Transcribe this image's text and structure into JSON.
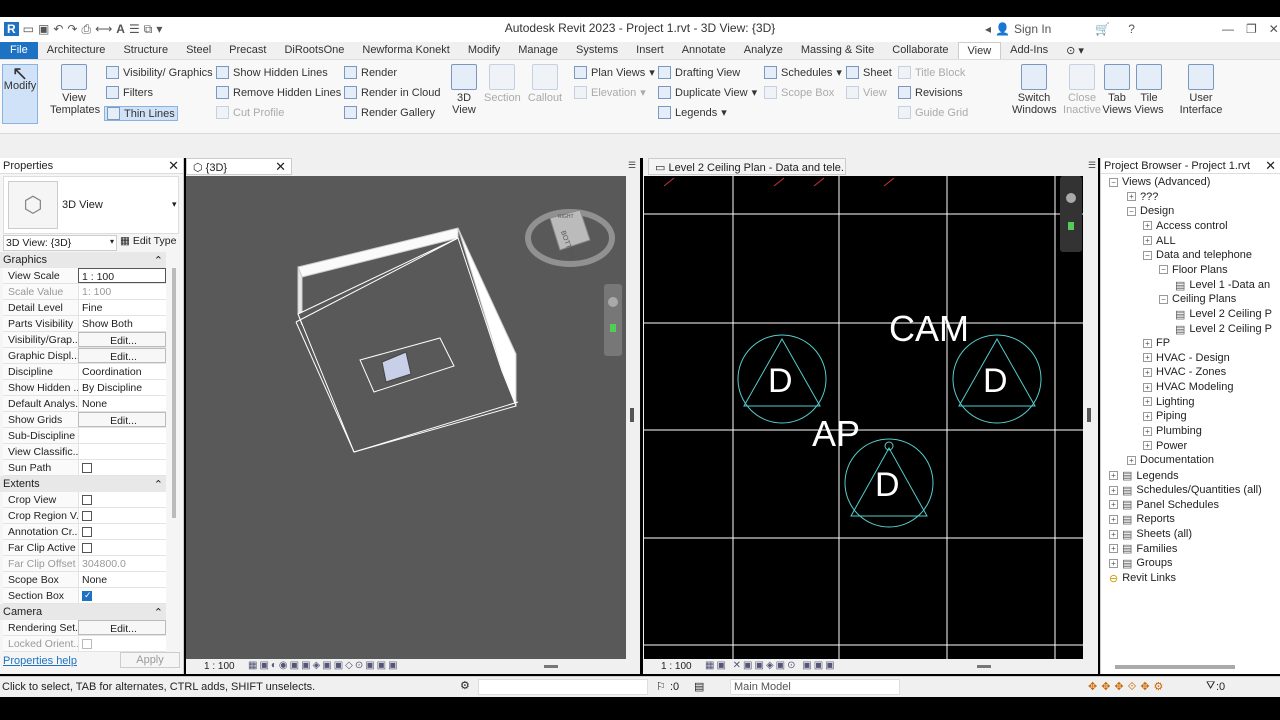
{
  "window": {
    "title": "Autodesk Revit 2023 - Project 1.rvt - 3D View: {3D}",
    "sign_in": "Sign In"
  },
  "tabs": [
    "File",
    "Architecture",
    "Structure",
    "Steel",
    "Precast",
    "DiRootsOne",
    "Newforma Konekt",
    "Modify",
    "Manage",
    "Systems",
    "Insert",
    "Annotate",
    "Analyze",
    "Massing & Site",
    "Collaborate",
    "View",
    "Add-Ins"
  ],
  "ribbon": {
    "modify": "Modify",
    "view_templates": "View Templates",
    "visibility_graphics": "Visibility/ Graphics",
    "filters": "Filters",
    "thin_lines": "Thin Lines",
    "show_hidden_lines": "Show Hidden Lines",
    "remove_hidden_lines": "Remove Hidden Lines",
    "cut_profile": "Cut Profile",
    "render": "Render",
    "render_cloud": "Render in Cloud",
    "render_gallery": "Render Gallery",
    "view_3d": "3D View",
    "section": "Section",
    "callout": "Callout",
    "plan_views": "Plan Views",
    "elevation": "Elevation",
    "drafting_view": "Drafting View",
    "duplicate_view": "Duplicate View",
    "legends": "Legends",
    "schedules": "Schedules",
    "scope_box": "Scope Box",
    "sheet": "Sheet",
    "view": "View",
    "title_block": "Title Block",
    "revisions": "Revisions",
    "guide_grid": "Guide Grid",
    "switch_windows": "Switch Windows",
    "close_inactive": "Close Inactive",
    "tab_views": "Tab Views",
    "tile_views": "Tile Views",
    "user_interface": "User Interface"
  },
  "properties": {
    "title": "Properties",
    "type_name": "3D View",
    "selector": "3D View: {3D}",
    "edit_type": "Edit Type",
    "sections": {
      "graphics": "Graphics",
      "extents": "Extents",
      "camera": "Camera"
    },
    "graphics_rows": [
      {
        "k": "View Scale",
        "v": "1 : 100"
      },
      {
        "k": "Scale Value",
        "v": "1:  100"
      },
      {
        "k": "Detail Level",
        "v": "Fine"
      },
      {
        "k": "Parts Visibility",
        "v": "Show Both"
      },
      {
        "k": "Visibility/Grap...",
        "v": "Edit..."
      },
      {
        "k": "Graphic Displ...",
        "v": "Edit..."
      },
      {
        "k": "Discipline",
        "v": "Coordination"
      },
      {
        "k": "Show Hidden ...",
        "v": "By Discipline"
      },
      {
        "k": "Default Analys...",
        "v": "None"
      },
      {
        "k": "Show Grids",
        "v": "Edit..."
      },
      {
        "k": "Sub-Discipline",
        "v": ""
      },
      {
        "k": "View Classific...",
        "v": ""
      },
      {
        "k": "Sun Path",
        "v": ""
      }
    ],
    "extents_rows": [
      {
        "k": "Crop View",
        "v": ""
      },
      {
        "k": "Crop Region V...",
        "v": ""
      },
      {
        "k": "Annotation Cr...",
        "v": ""
      },
      {
        "k": "Far Clip Active",
        "v": ""
      },
      {
        "k": "Far Clip Offset",
        "v": "304800.0"
      },
      {
        "k": "Scope Box",
        "v": "None"
      },
      {
        "k": "Section Box",
        "v": ""
      }
    ],
    "camera_rows": [
      {
        "k": "Rendering Set...",
        "v": "Edit..."
      },
      {
        "k": "Locked Orient...",
        "v": ""
      }
    ],
    "help": "Properties help",
    "apply": "Apply"
  },
  "view3d": {
    "tab": "{3D}",
    "scale": "1 : 100",
    "cube_label": "BOTTOM",
    "cube_front": "RIGHT"
  },
  "ceiling_view": {
    "tab": "Level 2 Ceiling Plan - Data and tele...",
    "scale": "1 : 100",
    "labels": {
      "cam": "CAM",
      "ap": "AP",
      "d": "D"
    }
  },
  "browser": {
    "title": "Project Browser - Project 1.rvt",
    "items": [
      "Views (Advanced)",
      "???",
      "Design",
      "Access control",
      "ALL",
      "Data and telephone",
      "Floor Plans",
      "Level 1 -Data an",
      "Ceiling Plans",
      "Level 2 Ceiling P",
      "Level 2 Ceiling P",
      "FP",
      "HVAC - Design",
      "HVAC - Zones",
      "HVAC Modeling",
      "Lighting",
      "Piping",
      "Plumbing",
      "Power",
      "Documentation",
      "Legends",
      "Schedules/Quantities (all)",
      "Panel Schedules",
      "Reports",
      "Sheets (all)",
      "Families",
      "Groups",
      "Revit Links"
    ]
  },
  "status": {
    "message": "Click to select, TAB for alternates, CTRL adds, SHIFT unselects.",
    "zero": ":0",
    "main_model": "Main Model",
    "filter": ":0"
  }
}
